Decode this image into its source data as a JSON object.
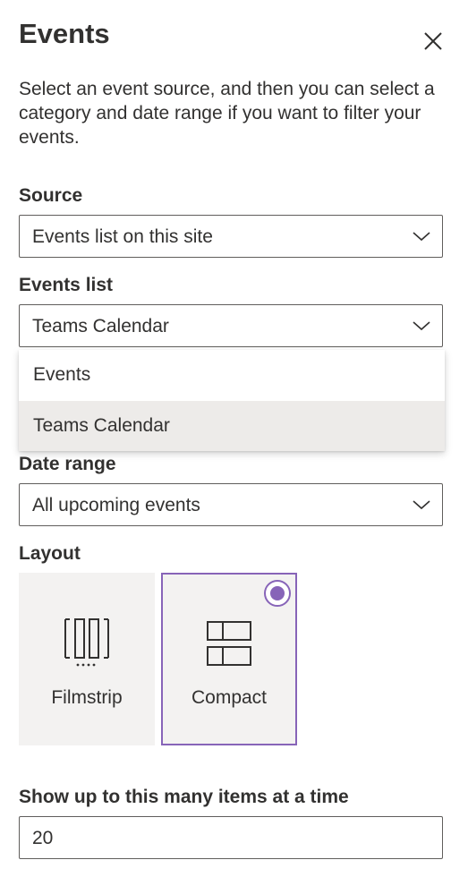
{
  "panel": {
    "title": "Events",
    "description": "Select an event source, and then you can select a category and date range if you want to filter your events."
  },
  "source": {
    "label": "Source",
    "value": "Events list on this site"
  },
  "events_list": {
    "label": "Events list",
    "value": "Teams Calendar",
    "options": [
      "Events",
      "Teams Calendar"
    ],
    "selected_option": "Teams Calendar"
  },
  "date_range": {
    "label": "Date range",
    "value": "All upcoming events"
  },
  "layout": {
    "label": "Layout",
    "options": [
      {
        "label": "Filmstrip",
        "icon": "filmstrip-icon",
        "selected": false
      },
      {
        "label": "Compact",
        "icon": "compact-icon",
        "selected": true
      }
    ]
  },
  "items_count": {
    "label": "Show up to this many items at a time",
    "value": "20"
  },
  "colors": {
    "accent": "#8764b8",
    "text": "#323130",
    "border": "#605e5c",
    "card_bg": "#f3f2f1",
    "hover_bg": "#edebe9"
  }
}
